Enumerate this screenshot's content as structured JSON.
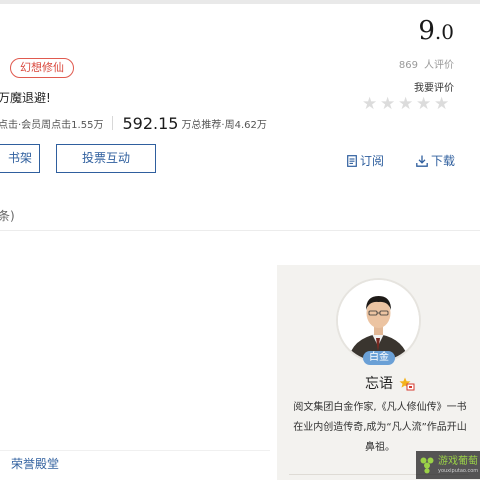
{
  "book": {
    "genre_tag": "幻想修仙",
    "tagline": "万魔退避!",
    "clicks_text": "点击·会员周点击1.55万",
    "recommend_num": "592.15",
    "recommend_text": "万总推荐·周4.62万"
  },
  "actions": {
    "shelf_label": "书架",
    "vote_label": "投票互动",
    "subscribe_label": "订阅",
    "download_label": "下载"
  },
  "comments": {
    "count_fragment": "条)"
  },
  "rating": {
    "score_int": "9",
    "score_dec": ".0",
    "count": "869",
    "count_suffix": "人评价",
    "rate_label": "我要评价",
    "stars": [
      "★",
      "★",
      "★",
      "★",
      "★"
    ]
  },
  "author": {
    "level": "白金",
    "name": "忘语",
    "bio": "阅文集团白金作家,《凡人修仙传》一书在业内创造传奇,成为“凡人流”作品开山鼻祖。"
  },
  "footer": {
    "honor_hall": "荣誉殿堂"
  },
  "watermark": {
    "main": "游戏葡萄",
    "sub": "youxiputao.com"
  },
  "colors": {
    "accent_blue": "#2f5f9e",
    "tag_red": "#d9473c",
    "badge_blue": "#6aa0d6",
    "card_bg": "#f3f2ef"
  }
}
